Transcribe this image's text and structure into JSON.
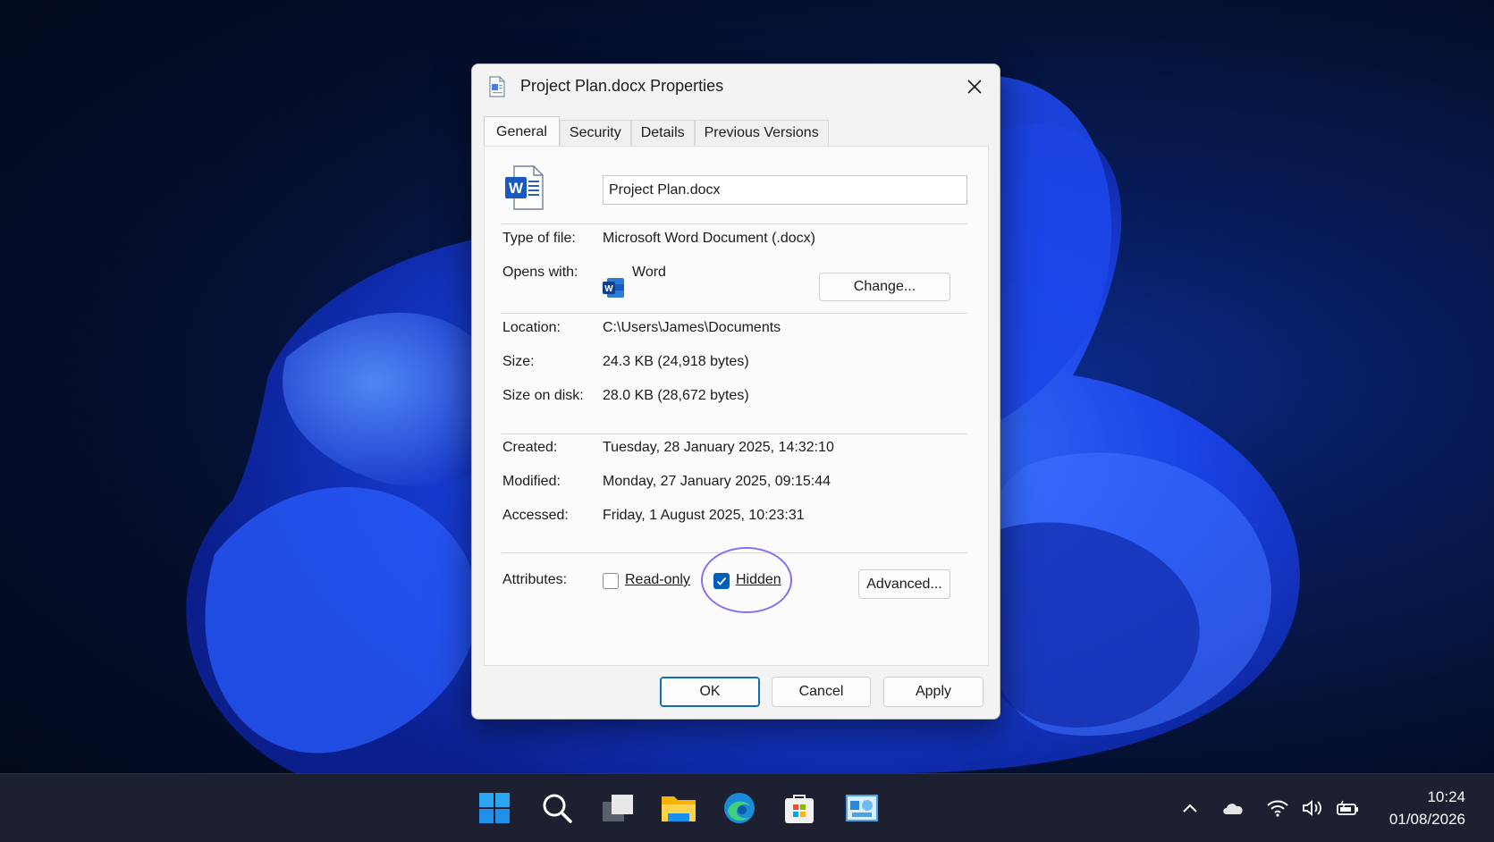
{
  "dialog": {
    "title": "Project Plan.docx Properties",
    "tabs": [
      "General",
      "Security",
      "Details",
      "Previous Versions"
    ],
    "active_tab": "General",
    "file_name": "Project Plan.docx",
    "rows": {
      "type_label": "Type of file:",
      "type_value": "Microsoft Word Document (.docx)",
      "opens_label": "Opens with:",
      "opens_value": "Word",
      "change_button": "Change...",
      "location_label": "Location:",
      "location_value": "C:\\Users\\James\\Documents",
      "size_label": "Size:",
      "size_value": "24.3 KB (24,918 bytes)",
      "size_disk_label": "Size on disk:",
      "size_disk_value": "28.0 KB (28,672 bytes)",
      "created_label": "Created:",
      "created_value": "Tuesday, 28 January 2025, 14:32:10",
      "modified_label": "Modified:",
      "modified_value": "Monday, 27 January 2025, 09:15:44",
      "accessed_label": "Accessed:",
      "accessed_value": "Friday, 1 August 2025, 10:23:31",
      "attributes_label": "Attributes:"
    },
    "attributes": {
      "readonly_label": "Read-only",
      "readonly_checked": false,
      "hidden_label": "Hidden",
      "hidden_checked": true,
      "advanced_button": "Advanced..."
    },
    "footer": {
      "ok": "OK",
      "cancel": "Cancel",
      "apply": "Apply"
    }
  },
  "taskbar": {
    "apps": [
      "start-icon",
      "search-icon",
      "task-view-icon",
      "file-explorer-icon",
      "edge-icon",
      "store-icon",
      "control-panel-icon"
    ],
    "tray": [
      "chevron-up-icon",
      "onedrive-icon",
      "wifi-icon",
      "volume-icon",
      "battery-icon"
    ],
    "time": "10:24",
    "date": "01/08/2026"
  },
  "colors": {
    "accent": "#005fb8",
    "highlight_ring": "#8b6cf0",
    "taskbar": "#1d2030"
  }
}
